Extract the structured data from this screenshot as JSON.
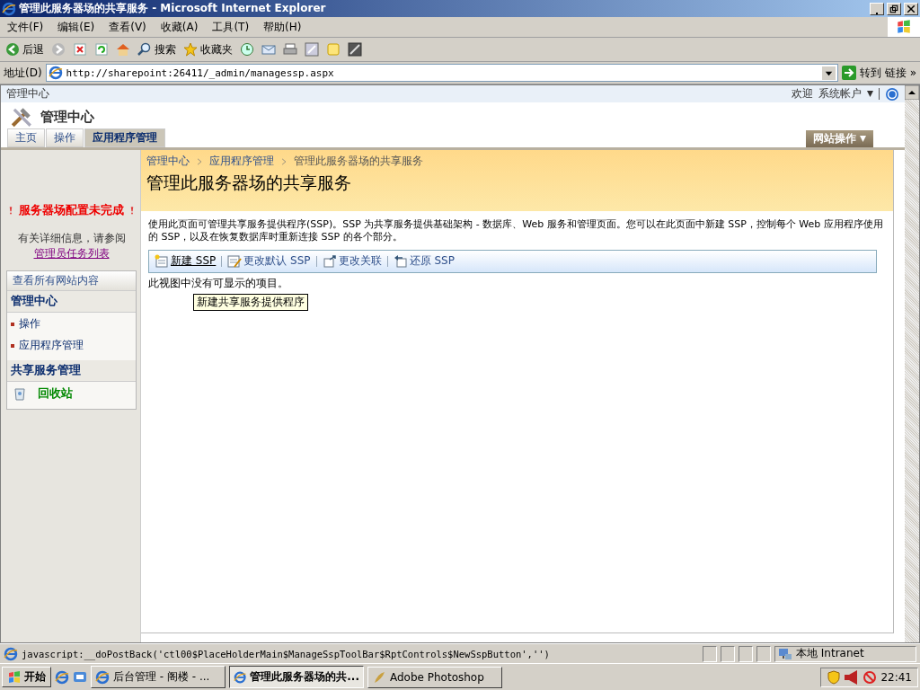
{
  "window": {
    "title": "管理此服务器场的共享服务 - Microsoft Internet Explorer"
  },
  "menu": [
    "文件(F)",
    "编辑(E)",
    "查看(V)",
    "收藏(A)",
    "工具(T)",
    "帮助(H)"
  ],
  "toolbar": [
    {
      "kind": "back",
      "label": "后退"
    },
    {
      "kind": "forward"
    },
    {
      "kind": "stop"
    },
    {
      "kind": "refresh"
    },
    {
      "kind": "home"
    },
    {
      "kind": "search",
      "label": "搜索"
    },
    {
      "kind": "favorites",
      "label": "收藏夹"
    },
    {
      "kind": "history"
    },
    {
      "kind": "mail"
    },
    {
      "kind": "print"
    },
    {
      "kind": "edit"
    },
    {
      "kind": "note"
    },
    {
      "kind": "messenger"
    }
  ],
  "address": {
    "label": "地址(D)",
    "value": "http://sharepoint:26411/_admin/managessp.aspx",
    "go": "转到",
    "links": "链接",
    "more": "»"
  },
  "top_bar": {
    "site": "管理中心",
    "welcome": "欢迎",
    "user": "系统帐户"
  },
  "header": {
    "title": "管理中心"
  },
  "tabs": [
    {
      "label": "主页",
      "selected": false
    },
    {
      "label": "操作",
      "selected": false
    },
    {
      "label": "应用程序管理",
      "selected": true
    }
  ],
  "site_actions": "网站操作",
  "sidebar": {
    "warning": "服务器场配置未完成",
    "info": "有关详细信息，请参阅",
    "info_link": "管理员任务列表",
    "view_all": "查看所有网站内容",
    "sections": [
      {
        "title": "管理中心",
        "items": [
          "操作",
          "应用程序管理"
        ]
      },
      {
        "title": "共享服务管理"
      }
    ],
    "recycle": "回收站"
  },
  "breadcrumb": [
    "管理中心",
    "应用程序管理",
    "管理此服务器场的共享服务"
  ],
  "heading": "管理此服务器场的共享服务",
  "description": "使用此页面可管理共享服务提供程序(SSP)。SSP 为共享服务提供基础架构 - 数据库、Web 服务和管理页面。您可以在此页面中新建 SSP，控制每个 Web 应用程序使用的 SSP，以及在恢复数据库时重新连接 SSP 的各个部分。",
  "actions": [
    {
      "kind": "new",
      "label": "新建 SSP",
      "hovered": true
    },
    {
      "kind": "default",
      "label": "更改默认 SSP",
      "hovered": false
    },
    {
      "kind": "assoc",
      "label": "更改关联",
      "hovered": false
    },
    {
      "kind": "restore",
      "label": "还原 SSP",
      "hovered": false
    }
  ],
  "empty_text": "此视图中没有可显示的项目。",
  "tooltip": "新建共享服务提供程序",
  "status_bar": {
    "text": "javascript:__doPostBack('ctl00$PlaceHolderMain$ManageSspToolBar$RptControls$NewSspButton','')",
    "zone": "本地 Intranet"
  },
  "taskbar": {
    "start": "开始",
    "tasks": [
      {
        "label": "后台管理 - 阁楼 - ...",
        "selected": false
      },
      {
        "label": "管理此服务器场的共...",
        "selected": true
      },
      {
        "label": "Adobe Photoshop",
        "selected": false
      }
    ],
    "clock": "22:41"
  }
}
